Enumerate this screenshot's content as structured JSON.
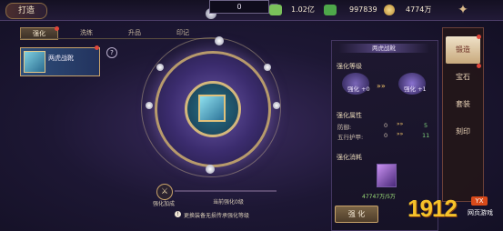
{
  "header": {
    "title": "打造"
  },
  "resources": {
    "input_value": "0",
    "items": [
      {
        "name": "silver",
        "value": "1.02亿",
        "icon": "cash-icon",
        "color": "#7ac15a"
      },
      {
        "name": "jade",
        "value": "997839",
        "icon": "gem-icon",
        "color": "#4ea84a"
      },
      {
        "name": "gold",
        "value": "4774万",
        "icon": "gold-coin-icon",
        "color": "#d8b45a"
      }
    ]
  },
  "tabs": [
    {
      "label": "强化",
      "active": true
    },
    {
      "label": "洗练",
      "active": false
    },
    {
      "label": "升品",
      "active": false
    },
    {
      "label": "印记",
      "active": false
    }
  ],
  "equip": {
    "name": "两虎战靴"
  },
  "bottom": {
    "bonus_label": "强化加成",
    "current_label": "当前强化0级",
    "hint": "更换装备无损传承强化等级"
  },
  "panel": {
    "title": "两虎战靴",
    "level_header": "强化等级",
    "level_from": "强化 +0",
    "level_to": "强化 +1",
    "attr_header": "强化属性",
    "attrs": [
      {
        "label": "防御:",
        "from": "0",
        "to": "5"
      },
      {
        "label": "五行护甲:",
        "from": "0",
        "to": "11"
      }
    ],
    "cost_header": "强化消耗",
    "cost_value": "47747万/5万",
    "button": "强 化"
  },
  "sidebar": [
    {
      "label": "锻造",
      "active": true
    },
    {
      "label": "宝石",
      "active": false
    },
    {
      "label": "套装",
      "active": false
    },
    {
      "label": "刻印",
      "active": false
    }
  ],
  "watermark": {
    "brand": "1912",
    "sub": "网页游戏",
    "badge": "YX"
  }
}
